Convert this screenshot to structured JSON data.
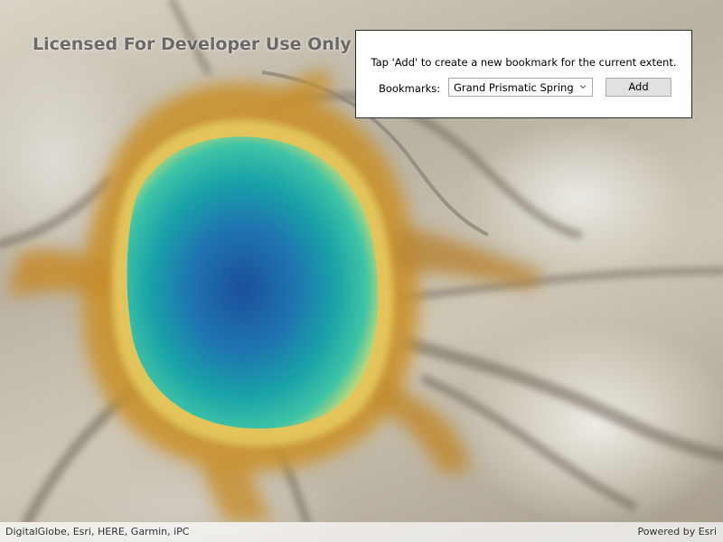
{
  "map": {
    "watermark": "Licensed For Developer Use Only",
    "attribution": "DigitalGlobe, Esri, HERE, Garmin, iPC",
    "powered_by": "Powered by Esri"
  },
  "bookmark_panel": {
    "instructions": "Tap 'Add' to create a new bookmark for the current extent.",
    "bookmarks_label": "Bookmarks:",
    "selected_bookmark": "Grand Prismatic Spring",
    "add_label": "Add",
    "select_icon": "chevron-down-icon"
  },
  "colors": {
    "panel_background": "#ffffff",
    "panel_border": "#2b2b2b",
    "button_background": "#e1e1e1",
    "spring_center": "#1b4f9c",
    "spring_teal": "#1aa9a0",
    "spring_ring": "#d9a93c"
  }
}
